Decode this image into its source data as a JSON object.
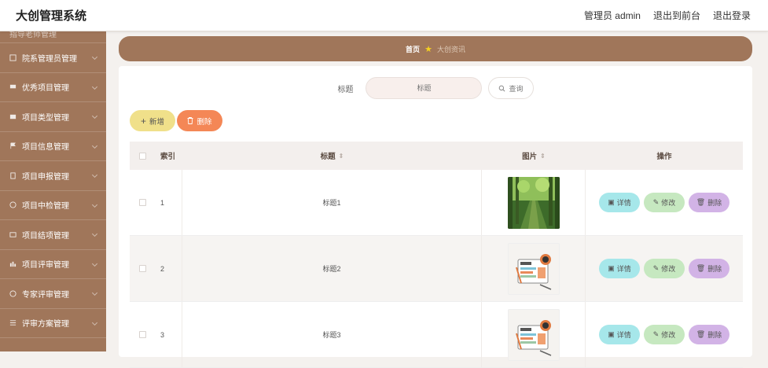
{
  "header": {
    "title": "大创管理系统",
    "user": "管理员 admin",
    "to_front": "退出到前台",
    "logout": "退出登录"
  },
  "sidebar": {
    "items": [
      {
        "label": "指导老师管理"
      },
      {
        "label": "院系管理员管理"
      },
      {
        "label": "优秀项目管理"
      },
      {
        "label": "项目类型管理"
      },
      {
        "label": "项目信息管理"
      },
      {
        "label": "项目申报管理"
      },
      {
        "label": "项目中检管理"
      },
      {
        "label": "项目结项管理"
      },
      {
        "label": "项目评审管理"
      },
      {
        "label": "专家评审管理"
      },
      {
        "label": "评审方案管理"
      }
    ]
  },
  "breadcrumb": {
    "home": "首页",
    "current": "大创资讯"
  },
  "search": {
    "label": "标题",
    "placeholder": "标题",
    "button": "查询"
  },
  "actions": {
    "add": "新增",
    "delete": "删除"
  },
  "table": {
    "headers": {
      "index": "索引",
      "title": "标题",
      "image": "图片",
      "ops": "操作"
    },
    "rows": [
      {
        "index": "1",
        "title": "标题1",
        "image": "forest-path"
      },
      {
        "index": "2",
        "title": "标题2",
        "image": "news-icon"
      },
      {
        "index": "3",
        "title": "标题3",
        "image": "news-icon"
      }
    ],
    "ops": {
      "detail": "详情",
      "edit": "修改",
      "remove": "删除"
    }
  },
  "colors": {
    "sidebar": "#a0765a",
    "add_btn": "#f0e08a",
    "del_btn": "#f48756",
    "detail_btn": "#a6e7ea",
    "edit_btn": "#c6e8c0",
    "remove_btn": "#d2b3e6"
  }
}
